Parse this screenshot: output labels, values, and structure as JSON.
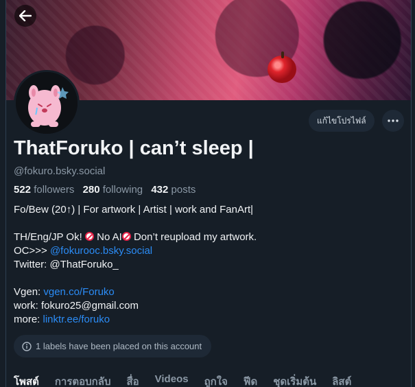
{
  "header": {
    "back_icon": "arrow-left-icon"
  },
  "profile": {
    "display_name": "ThatForuko | can’t sleep |",
    "handle": "@fokuro.bsky.social",
    "edit_profile_label": "แก้ไขโปรไฟล์",
    "more_icon": "ellipsis-icon",
    "stats": {
      "followers_count": "522",
      "followers_label": "followers",
      "following_count": "280",
      "following_label": "following",
      "posts_count": "432",
      "posts_label": "posts"
    },
    "bio": {
      "line1": "Fo/Bew (20↑) | For artwork | Artist | work and FanArt|",
      "line2_a": "TH/Eng/JP Ok! ",
      "line2_b": "No AI",
      "line2_c": "Don’t reupload my artwork.",
      "line3_prefix": "OC>>> ",
      "line3_link": "@fokurooc.bsky.social",
      "line4": "Twitter: @ThatForuko_",
      "vgen_prefix": "Vgen: ",
      "vgen_link": "vgen.co/Foruko",
      "work": "work: fokuro25@gmail.com",
      "more_prefix": "more: ",
      "more_link": "linktr.ee/foruko"
    },
    "labels_notice": "1 labels have been placed on this account"
  },
  "tabs": [
    {
      "label": "โพสต์",
      "active": true
    },
    {
      "label": "การตอบกลับ",
      "active": false
    },
    {
      "label": "สื่อ",
      "active": false
    },
    {
      "label": "Videos",
      "active": false
    },
    {
      "label": "ถูกใจ",
      "active": false
    },
    {
      "label": "ฟีด",
      "active": false
    },
    {
      "label": "ชุดเริ่มต้น",
      "active": false
    },
    {
      "label": "ลิสต์",
      "active": false
    }
  ],
  "colors": {
    "background": "#161e27",
    "accent_link": "#2b8cf6",
    "muted_text": "#8b98a5",
    "pill_bg": "#1e2936"
  }
}
